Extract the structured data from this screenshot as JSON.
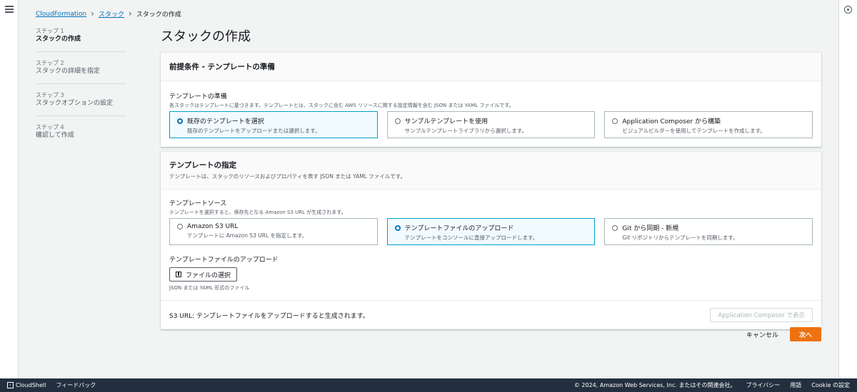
{
  "breadcrumb": {
    "items": [
      "CloudFormation",
      "スタック"
    ],
    "current": "スタックの作成"
  },
  "steps": [
    {
      "num": "ステップ 1",
      "title": "スタックの作成",
      "active": true
    },
    {
      "num": "ステップ 2",
      "title": "スタックの詳細を指定",
      "active": false
    },
    {
      "num": "ステップ 3",
      "title": "スタックオプションの設定",
      "active": false
    },
    {
      "num": "ステップ 4",
      "title": "確認して作成",
      "active": false
    }
  ],
  "page_title": "スタックの作成",
  "prereq": {
    "title": "前提条件 - テンプレートの準備",
    "field_label": "テンプレートの準備",
    "field_desc": "各スタックはテンプレートに基づきます。テンプレートとは、スタックに含む AWS リソースに関する設定情報を含む JSON または YAML ファイルです。",
    "options": [
      {
        "label": "既存のテンプレートを選択",
        "desc": "既存のテンプレートをアップロードまたは選択します。",
        "selected": true
      },
      {
        "label": "サンプルテンプレートを使用",
        "desc": "サンプルテンプレートライブラリから選択します。",
        "selected": false
      },
      {
        "label": "Application Composer から構築",
        "desc": "ビジュアルビルダーを使用してテンプレートを作成します。",
        "selected": false
      }
    ]
  },
  "spec": {
    "title": "テンプレートの指定",
    "desc": "テンプレートは、スタックのリソースおよびプロパティを表す JSON または YAML ファイルです。",
    "source_label": "テンプレートソース",
    "source_desc": "テンプレートを選択すると、保存先となる Amazon S3 URL が生成されます。",
    "options": [
      {
        "label": "Amazon S3 URL",
        "desc": "テンプレートに Amazon S3 URL を指定します。",
        "selected": false
      },
      {
        "label": "テンプレートファイルのアップロード",
        "desc": "テンプレートをコンソールに直接アップロードします。",
        "selected": true
      },
      {
        "label": "Git から同期 - 新規",
        "desc": "Git リポジトリからテンプレートを同期します。",
        "selected": false
      }
    ],
    "upload_label": "テンプレートファイルのアップロード",
    "upload_button": "ファイルの選択",
    "upload_hint": "JSON または YAML 形式のファイル",
    "s3_url_text": "S3 URL:  テンプレートファイルをアップロードすると生成されます。",
    "composer_button": "Application Composer で表示"
  },
  "actions": {
    "cancel": "キャンセル",
    "next": "次へ"
  },
  "footer": {
    "cloudshell": "CloudShell",
    "feedback": "フィードバック",
    "copyright": "© 2024, Amazon Web Services, Inc. またはその関連会社。",
    "privacy": "プライバシー",
    "terms": "用語",
    "cookie": "Cookie の設定"
  },
  "colors": {
    "primary": "#ec7211",
    "link": "#0073bb",
    "selected_border": "#00a1c9",
    "footer_bg": "#232f3e"
  }
}
